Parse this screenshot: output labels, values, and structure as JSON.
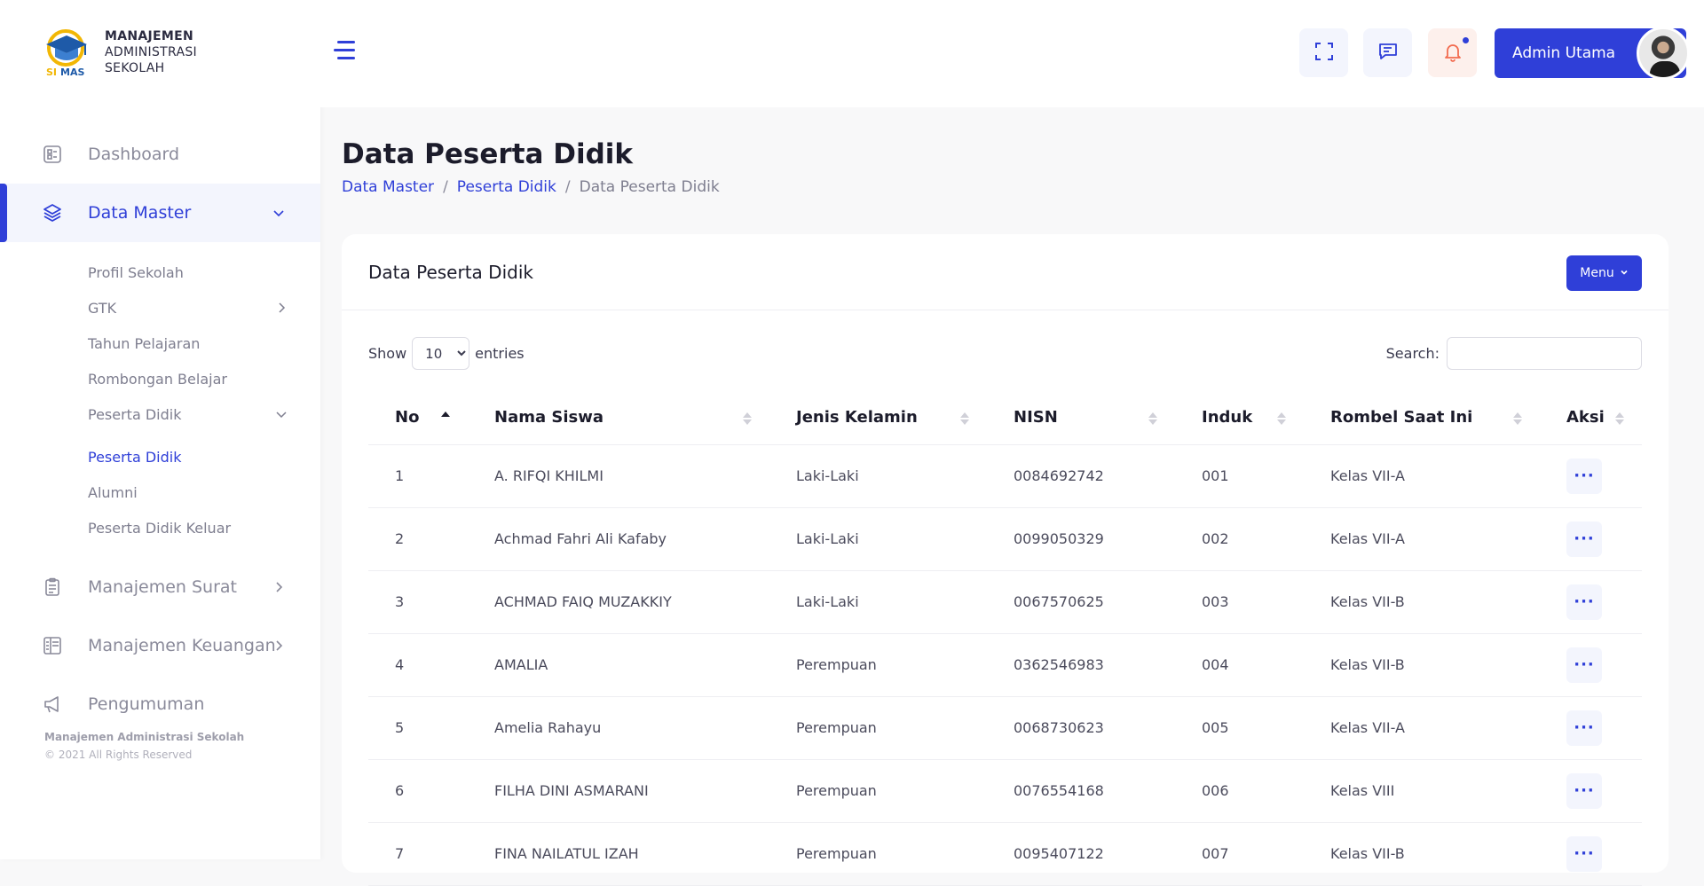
{
  "brand": {
    "line1": "MANAJEMEN",
    "line2": "ADMINISTRASI",
    "line3": "SEKOLAH",
    "logo_text": "SIMAS"
  },
  "sidebar": {
    "items": [
      {
        "label": "Dashboard",
        "icon": "dashboard-icon"
      },
      {
        "label": "Data Master",
        "icon": "layers-icon"
      },
      {
        "label": "Manajemen Surat",
        "icon": "clipboard-icon"
      },
      {
        "label": "Manajemen Keuangan",
        "icon": "ledger-icon"
      },
      {
        "label": "Pengumuman",
        "icon": "megaphone-icon"
      }
    ],
    "submenu": [
      "Profil Sekolah",
      "GTK",
      "Tahun Pelajaran",
      "Rombongan Belajar",
      "Peserta Didik",
      "Peserta Didik",
      "Alumni",
      "Peserta Didik Keluar"
    ],
    "footer_title": "Manajemen Administrasi Sekolah",
    "footer_copy": "© 2021 All Rights Reserved"
  },
  "header": {
    "user_name": "Admin Utama"
  },
  "page": {
    "title": "Data Peserta Didik",
    "breadcrumb": [
      "Data Master",
      "Peserta Didik",
      "Data Peserta Didik"
    ],
    "separator": "/"
  },
  "card": {
    "title": "Data Peserta Didik",
    "menu_label": "Menu",
    "show_label": "Show",
    "entries_label": "entries",
    "page_length": "10",
    "search_label": "Search:"
  },
  "table": {
    "columns": [
      "No",
      "Nama Siswa",
      "Jenis Kelamin",
      "NISN",
      "Induk",
      "Rombel Saat Ini",
      "Aksi"
    ],
    "rows": [
      [
        "1",
        "A. RIFQI KHILMI",
        "Laki-Laki",
        "0084692742",
        "001",
        "Kelas VII-A"
      ],
      [
        "2",
        "Achmad Fahri Ali Kafaby",
        "Laki-Laki",
        "0099050329",
        "002",
        "Kelas VII-A"
      ],
      [
        "3",
        "ACHMAD FAIQ MUZAKKIY",
        "Laki-Laki",
        "0067570625",
        "003",
        "Kelas VII-B"
      ],
      [
        "4",
        "AMALIA",
        "Perempuan",
        "0362546983",
        "004",
        "Kelas VII-B"
      ],
      [
        "5",
        "Amelia Rahayu",
        "Perempuan",
        "0068730623",
        "005",
        "Kelas VII-A"
      ],
      [
        "6",
        "FILHA DINI ASMARANI",
        "Perempuan",
        "0076554168",
        "006",
        "Kelas VIII"
      ],
      [
        "7",
        "FINA NAILATUL IZAH",
        "Perempuan",
        "0095407122",
        "007",
        "Kelas VII-B"
      ]
    ]
  },
  "colors": {
    "accent": "#2f3fd8",
    "bell_bg": "#fdf0ec",
    "logo_blue": "#1e5aa8",
    "logo_gold": "#f2b705"
  }
}
